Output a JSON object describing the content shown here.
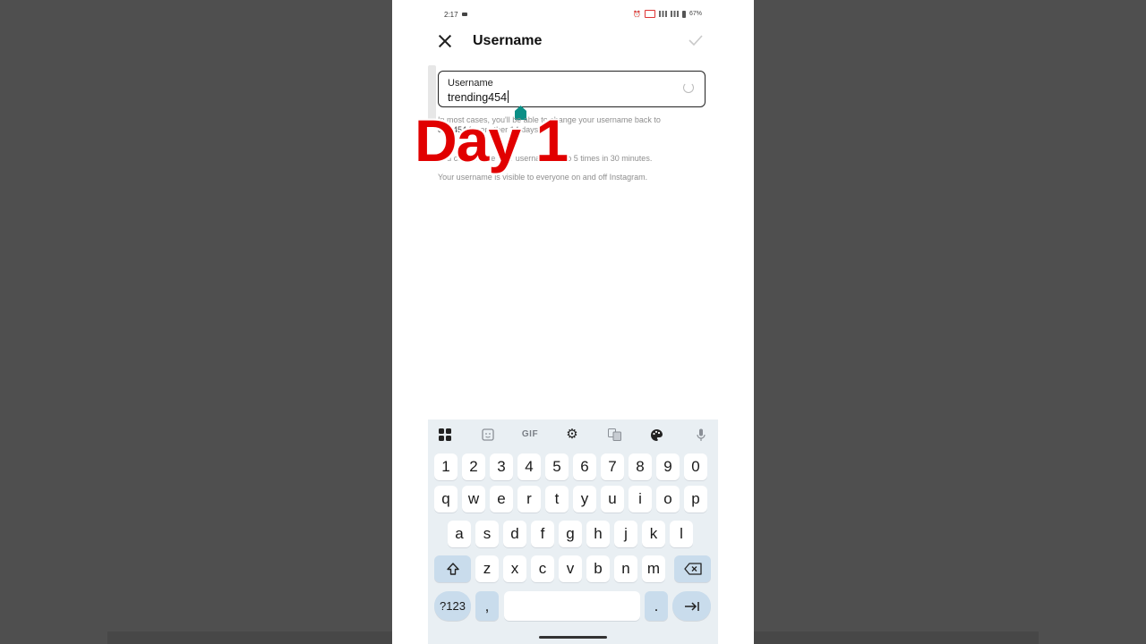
{
  "status_bar": {
    "time": "2:17",
    "battery": "67%"
  },
  "app_bar": {
    "title": "Username"
  },
  "username_field": {
    "label": "Username",
    "value": "trending454"
  },
  "helper_text": {
    "line1_a": "In most cases, you'll be able to change your username back to",
    "line1_b": "ding454",
    "line1_c": " for another 14 days.",
    "line2": "You can change your username up to 5 times in 30 minutes.",
    "line3": "Your username is visible to everyone on and off Instagram."
  },
  "overlay": {
    "text": "Day 1"
  },
  "keyboard": {
    "toolbar": {
      "gif": "GIF"
    },
    "rows": {
      "numbers": [
        "1",
        "2",
        "3",
        "4",
        "5",
        "6",
        "7",
        "8",
        "9",
        "0"
      ],
      "row1": [
        "q",
        "w",
        "e",
        "r",
        "t",
        "y",
        "u",
        "i",
        "o",
        "p"
      ],
      "row2": [
        "a",
        "s",
        "d",
        "f",
        "g",
        "h",
        "j",
        "k",
        "l"
      ],
      "row3": [
        "z",
        "x",
        "c",
        "v",
        "b",
        "n",
        "m"
      ]
    },
    "symbols_key": "?123",
    "comma_key": ",",
    "period_key": "."
  },
  "icons": {
    "close": "close-icon",
    "confirm": "check-icon",
    "loading": "spinner-icon",
    "shift": "shift-icon",
    "backspace": "backspace-icon",
    "enter": "tab-arrow-icon"
  },
  "colors": {
    "overlay_red": "#e10000",
    "text_handle": "#0a8f86",
    "keyboard_bg": "#e9eff3",
    "special_key_bg": "#c9dcec"
  }
}
